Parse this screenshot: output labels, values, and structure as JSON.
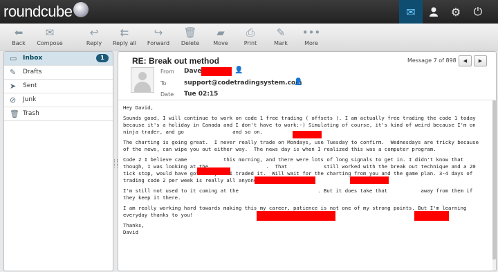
{
  "app": {
    "logo_text": "roundcube"
  },
  "topnav": {
    "mail_icon": "mail-icon",
    "contacts_icon": "user-icon",
    "settings_icon": "gear-icon",
    "logout_icon": "power-icon"
  },
  "toolbar": {
    "back": "Back",
    "compose": "Compose",
    "reply": "Reply",
    "reply_all": "Reply all",
    "forward": "Forward",
    "delete": "Delete",
    "move": "Move",
    "print": "Print",
    "mark": "Mark",
    "more": "More"
  },
  "folders": [
    {
      "label": "Inbox",
      "icon": "inbox-icon",
      "unread": "1",
      "selected": true
    },
    {
      "label": "Drafts",
      "icon": "pencil-icon"
    },
    {
      "label": "Sent",
      "icon": "sent-icon"
    },
    {
      "label": "Junk",
      "icon": "junk-icon"
    },
    {
      "label": "Trash",
      "icon": "trash-icon"
    }
  ],
  "message": {
    "subject": "RE: Break out method",
    "count": "Message 7 of 898",
    "from_label": "From",
    "from_value": "Dave",
    "to_label": "To",
    "to_value": "support@codetradingsystem.com",
    "date_label": "Date",
    "date_value": "Tue 02:15",
    "body": [
      "Hey David,",
      "Sounds good, I will continue to work on code 1 free trading ( offsets ). I am actually free trading the code 1 today because it's a holiday in Canada and I don't have to work:-) Simulating of course, it's kind of weird because I'm on ninja trader, and go                and so on.",
      "The charting is going great.  I never really trade on Mondays, use Tuesday to confirm.  Wednesdays are tricky because of the news, can wipe you out either way.  The news day is when I realized this was a computer program.",
      "Code 2 I believe came            this morning, and there were lots of long signals to get in. I didn't know that though, I was looking at the                   .  That            still worked with the break out technique and a 20 tick stop, would have got lucky if I traded it.  Will wait for the charting from you and the game plan. 3-4 days of trading code 2 per week is really all anyone should need.",
      "I'm still not used to it coming at the                          . But it does take that           away from them if they keep it there.",
      "I am really working hard towards making this my career, patience is not one of my strong points. But I'm learning everyday thanks to you!",
      "Thanks,\nDavid"
    ]
  },
  "colors": {
    "accent": "#1c5a78",
    "redaction": "#ff0000"
  }
}
